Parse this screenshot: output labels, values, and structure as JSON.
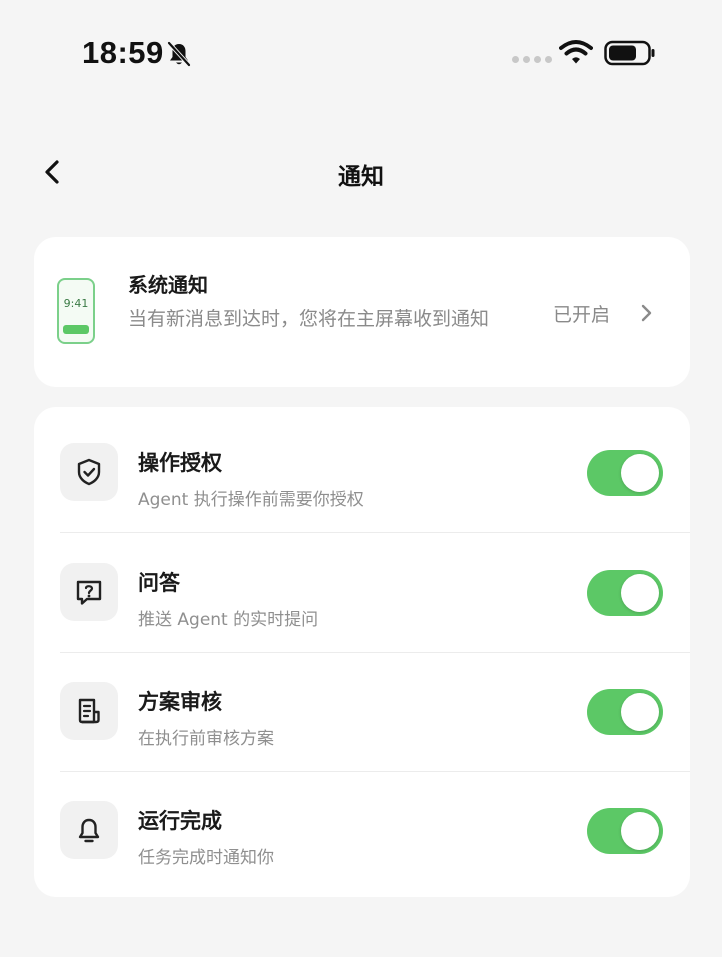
{
  "status_bar": {
    "time": "18:59",
    "icons": [
      "bell-slash-icon",
      "signal-dots-icon",
      "wifi-icon",
      "battery-icon"
    ]
  },
  "nav": {
    "back_icon": "chevron-left-icon",
    "title": "通知"
  },
  "system_notification": {
    "title": "系统通知",
    "description": "当有新消息到达时，您将在主屏幕收到通知",
    "status": "已开启",
    "illustration_time": "9:41",
    "accent_color": "#5cc866"
  },
  "settings": [
    {
      "icon": "shield-check-icon",
      "title": "操作授权",
      "description": "Agent 执行操作前需要你授权",
      "enabled": true
    },
    {
      "icon": "question-bubble-icon",
      "title": "问答",
      "description": "推送 Agent 的实时提问",
      "enabled": true
    },
    {
      "icon": "document-list-icon",
      "title": "方案审核",
      "description": "在执行前审核方案",
      "enabled": true
    },
    {
      "icon": "bell-icon",
      "title": "运行完成",
      "description": "任务完成时通知你",
      "enabled": true
    }
  ],
  "colors": {
    "toggle_on": "#5cc866",
    "background": "#f5f5f5",
    "card": "#ffffff"
  }
}
